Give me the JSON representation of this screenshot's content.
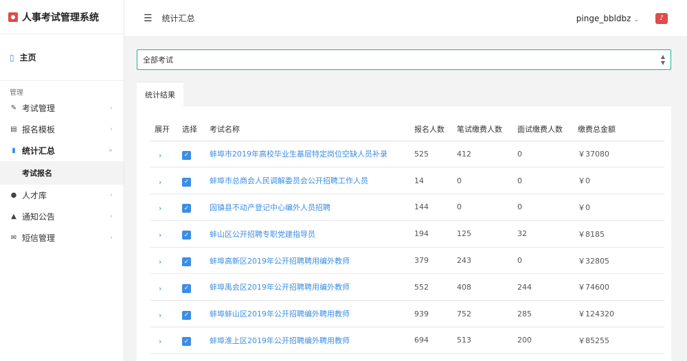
{
  "brand": {
    "title": "人事考试管理系统"
  },
  "sidebar": {
    "home_label": "主页",
    "section_label": "管理",
    "items": [
      {
        "label": "考试管理",
        "icon": "edit-icon"
      },
      {
        "label": "报名模板",
        "icon": "id-card-icon"
      },
      {
        "label": "统计汇总",
        "icon": "bar-chart-icon",
        "active": true
      },
      {
        "label": "人才库",
        "icon": "users-icon"
      },
      {
        "label": "通知公告",
        "icon": "bell-icon"
      },
      {
        "label": "短信管理",
        "icon": "envelope-icon"
      }
    ],
    "sub_item": "考试报名"
  },
  "topbar": {
    "title": "统计汇总",
    "user": "pinge_bbldbz"
  },
  "filter": {
    "selected": "全部考试"
  },
  "tab_label": "统计结果",
  "colors": {
    "accent": "#3a8ee6",
    "brand": "#e04b4b",
    "focus": "#1ab394"
  },
  "table": {
    "headers": [
      "展开",
      "选择",
      "考试名称",
      "报名人数",
      "笔试缴费人数",
      "面试缴费人数",
      "缴费总金额"
    ],
    "rows": [
      {
        "name": "蚌埠市2019年高校毕业生基层特定岗位空缺人员补录",
        "registered": "525",
        "written": "412",
        "interview": "0",
        "amount": "￥37080"
      },
      {
        "name": "蚌埠市总商会人民调解委员会公开招聘工作人员",
        "registered": "14",
        "written": "0",
        "interview": "0",
        "amount": "￥0"
      },
      {
        "name": "固镇县不动产登记中心编外人员招聘",
        "registered": "144",
        "written": "0",
        "interview": "0",
        "amount": "￥0"
      },
      {
        "name": "蚌山区公开招聘专职党建指导员",
        "registered": "194",
        "written": "125",
        "interview": "32",
        "amount": "￥8185"
      },
      {
        "name": "蚌埠高新区2019年公开招聘聘用编外教师",
        "registered": "379",
        "written": "243",
        "interview": "0",
        "amount": "￥32805"
      },
      {
        "name": "蚌埠禹会区2019年公开招聘聘用编外教师",
        "registered": "552",
        "written": "408",
        "interview": "244",
        "amount": "￥74600"
      },
      {
        "name": "蚌埠蚌山区2019年公开招聘编外聘用教师",
        "registered": "939",
        "written": "752",
        "interview": "285",
        "amount": "￥124320"
      },
      {
        "name": "蚌埠淮上区2019年公开招聘编外聘用教师",
        "registered": "694",
        "written": "513",
        "interview": "200",
        "amount": "￥85255"
      }
    ]
  }
}
